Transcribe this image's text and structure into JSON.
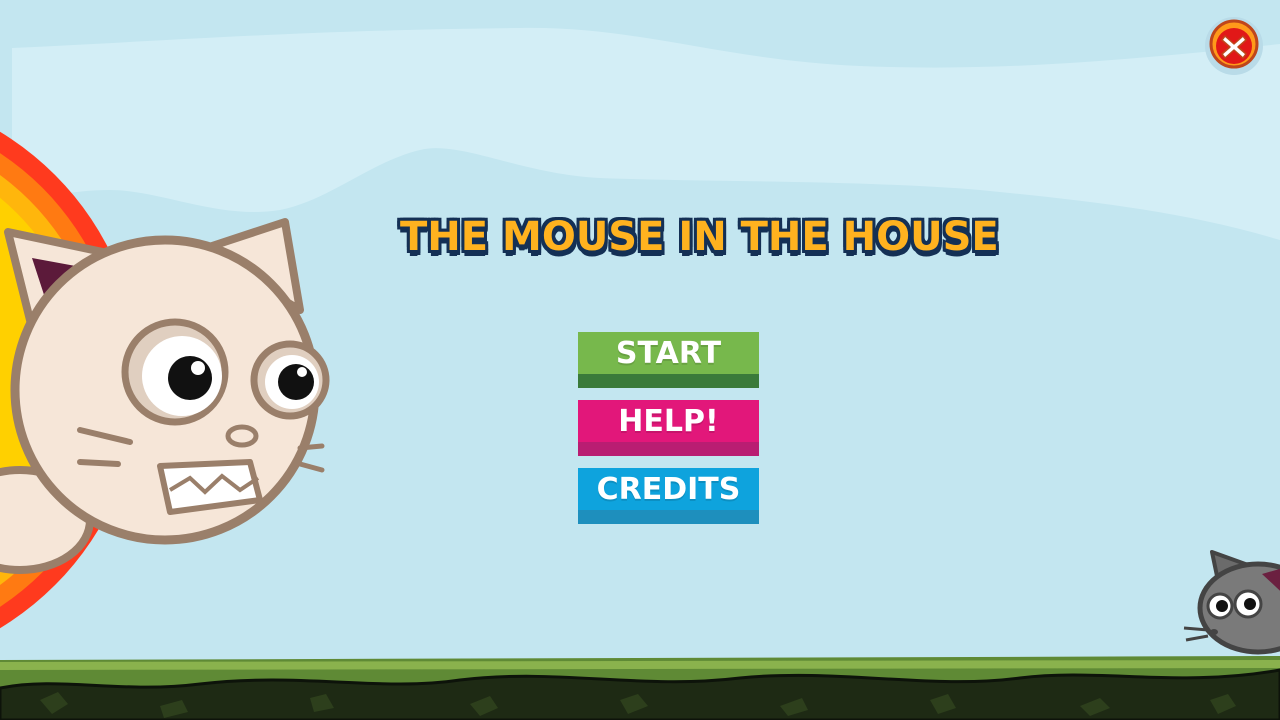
{
  "game": {
    "title": "THE MOUSE IN THE HOUSE"
  },
  "menu": {
    "start_label": "START",
    "help_label": "HELP!",
    "credits_label": "CREDITS"
  },
  "close_icon": "close-icon",
  "colors": {
    "sky": "#c3e6f0",
    "title_fill": "#ffb21f",
    "title_outline": "#143055",
    "start": "#77b84c",
    "help": "#e2177a",
    "credits": "#0ea3dd",
    "grass": "#5f8a35",
    "ground": "#1e2a14"
  }
}
